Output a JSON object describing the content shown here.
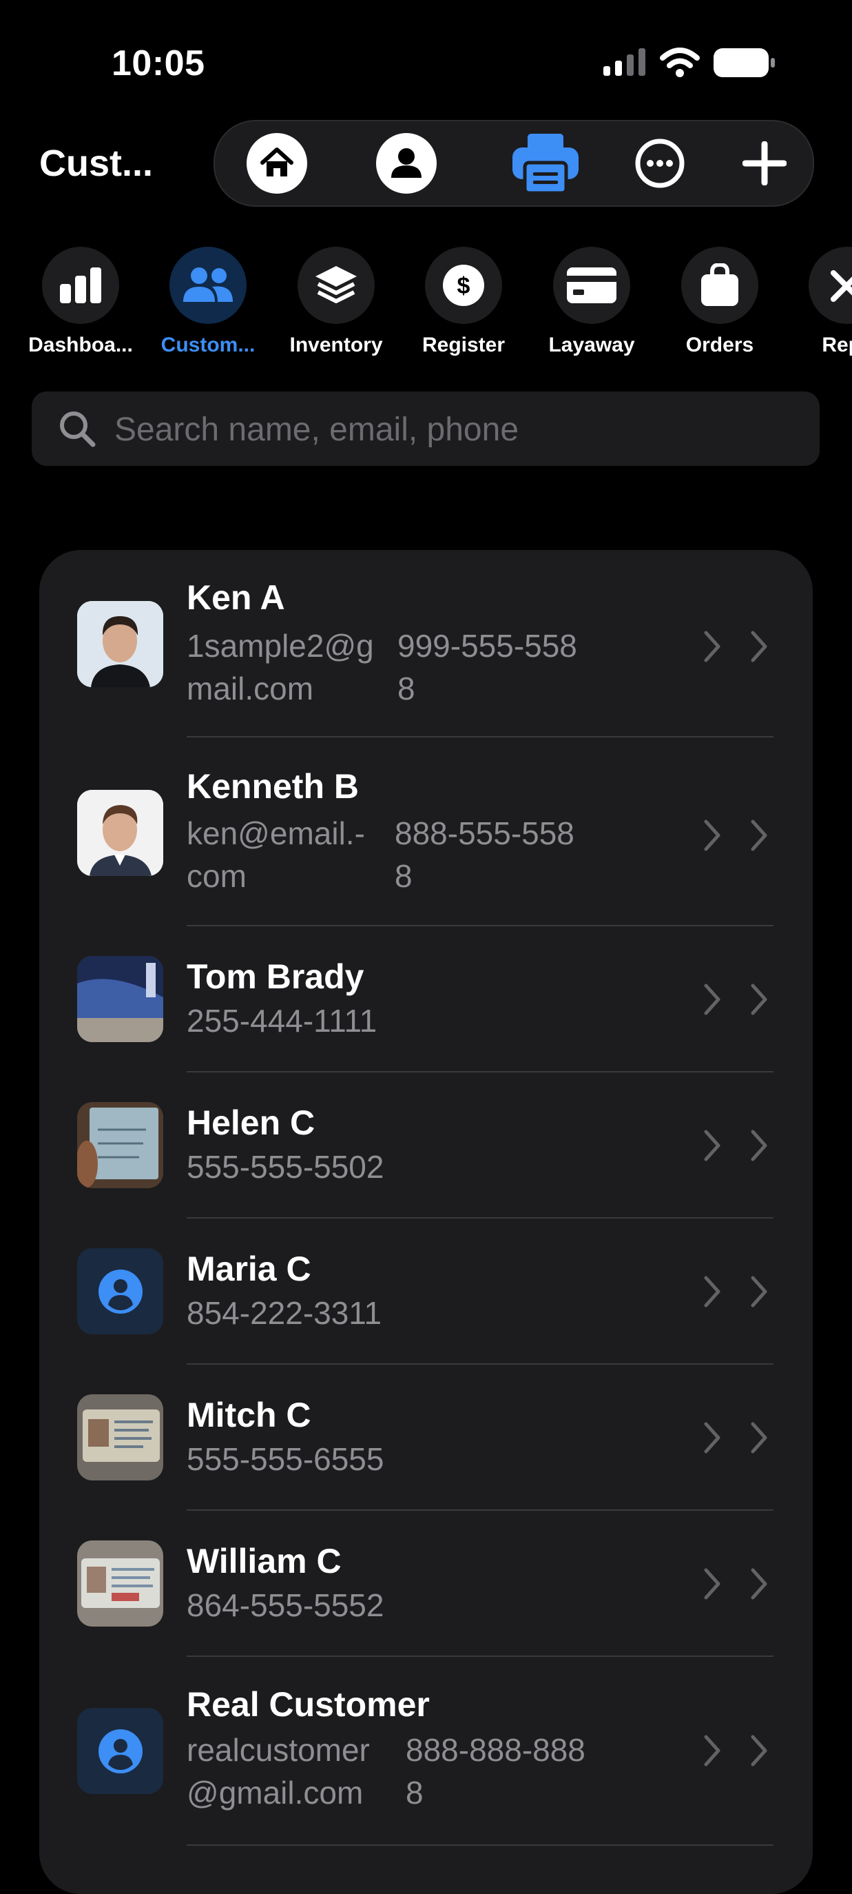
{
  "status_bar": {
    "time": "10:05"
  },
  "header": {
    "title": "Cust..."
  },
  "toolbar": {
    "buttons": [
      "home-icon",
      "person-icon",
      "printer-icon",
      "more-icon",
      "plus-icon"
    ],
    "accent": "#3d8ef5"
  },
  "modules": [
    {
      "label": "Dashboa...",
      "icon": "bar-chart-icon",
      "active": false
    },
    {
      "label": "Custom...",
      "icon": "people-icon",
      "active": true
    },
    {
      "label": "Inventory",
      "icon": "layers-icon",
      "active": false
    },
    {
      "label": "Register",
      "icon": "dollar-icon",
      "active": false
    },
    {
      "label": "Layaway",
      "icon": "card-icon",
      "active": false
    },
    {
      "label": "Orders",
      "icon": "bag-icon",
      "active": false
    },
    {
      "label": "Repa",
      "icon": "tools-icon",
      "active": false
    }
  ],
  "search": {
    "placeholder": "Search name, email, phone"
  },
  "customers": [
    {
      "name": "Ken A",
      "email_line1": "1sample2@g",
      "email_line2": "mail.com",
      "phone_line1": "999-555-558",
      "phone_line2": "8",
      "avatar": "photo-portrait"
    },
    {
      "name": "Kenneth B",
      "email_line1": "ken@email.-",
      "email_line2": "com",
      "phone_line1": "888-555-558",
      "phone_line2": "8",
      "avatar": "photo-portrait"
    },
    {
      "name": "Tom Brady",
      "phone": "255-444-1111",
      "avatar": "photo-phone"
    },
    {
      "name": "Helen C",
      "phone": "555-555-5502",
      "avatar": "photo-note"
    },
    {
      "name": "Maria C",
      "phone": "854-222-3311",
      "avatar": "placeholder"
    },
    {
      "name": "Mitch C",
      "phone": "555-555-6555",
      "avatar": "photo-id"
    },
    {
      "name": "William C",
      "phone": "864-555-5552",
      "avatar": "photo-id"
    },
    {
      "name": "Real Customer",
      "email_line1": "realcustomer",
      "email_line2": "@gmail.com",
      "phone_line1": "888-888-888",
      "phone_line2": "8",
      "avatar": "placeholder"
    }
  ]
}
